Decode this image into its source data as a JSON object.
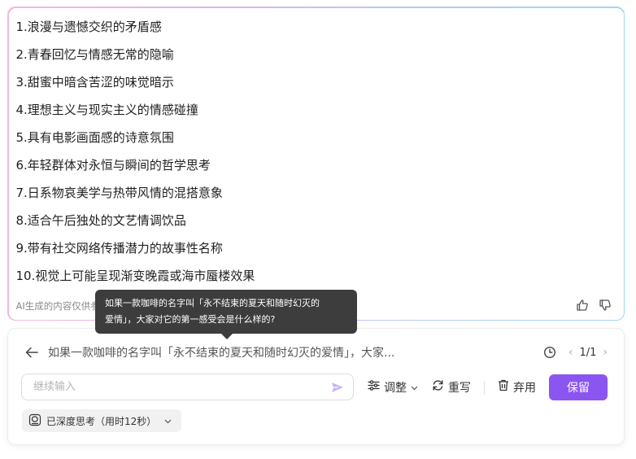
{
  "result": {
    "items": [
      "1.浪漫与遗憾交织的矛盾感",
      "2.青春回忆与情感无常的隐喻",
      "3.甜蜜中暗含苦涩的味觉暗示",
      "4.理想主义与现实主义的情感碰撞",
      "5.具有电影画面感的诗意氛围",
      "6.年轻群体对永恒与瞬间的哲学思考",
      "7.日系物哀美学与热带风情的混搭意象",
      "8.适合午后独处的文艺情调饮品",
      "9.带有社交网络传播潜力的故事性名称",
      "10.视觉上可能呈现渐变晚霞或海市蜃楼效果"
    ],
    "ai_note": "AI生成的内容仅供参考"
  },
  "tooltip": {
    "line1": "如果一款咖啡的名字叫「永不结束的夏天和随时幻灭的",
    "line2": "爱情」，大家对它的第一感受会是什么样的?"
  },
  "panel": {
    "question": "如果一款咖啡的名字叫「永不结束的夏天和随时幻灭的爱情」，大家...",
    "pager": "1/1",
    "input_placeholder": "继续输入",
    "adjust_label": "调整",
    "rewrite_label": "重写",
    "discard_label": "弃用",
    "keep_label": "保留",
    "think_label": "已深度思考（用时12秒）"
  },
  "colors": {
    "accent": "#8b55f2",
    "tooltip_bg": "#3d3d3d"
  },
  "icons": [
    "thumbs-up-icon",
    "thumbs-down-icon",
    "back-arrow-icon",
    "clock-icon",
    "chevron-left-icon",
    "chevron-right-icon",
    "send-icon",
    "sliders-icon",
    "chevron-down-icon",
    "refresh-icon",
    "trash-icon",
    "brain-icon"
  ]
}
